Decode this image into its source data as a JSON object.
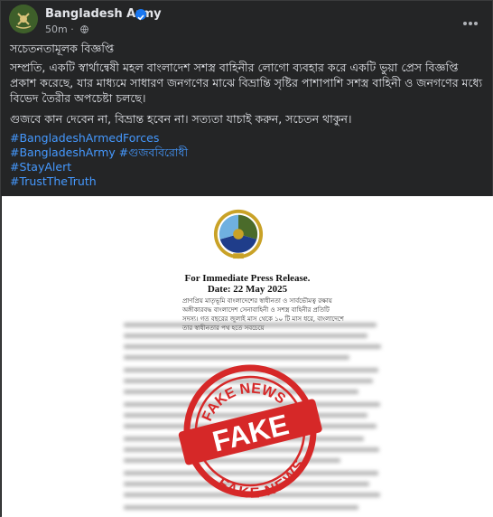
{
  "post": {
    "page_name": "Bangladesh Army",
    "time": "50m",
    "title": "সচেতনতামূলক বিজ্ঞপ্তি",
    "paragraph1": "সম্প্রতি, একটি স্বার্থান্বেষী মহল বাংলাদেশ সশস্ত্র বাহিনীর লোগো ব্যবহার করে একটি ভুয়া প্রেস বিজ্ঞপ্তি প্রকাশ করেছে, যার মাধ্যমে সাধারণ জনগণের মাঝে বিভ্রান্তি সৃষ্টির পাশাপাশি সশস্ত্র বাহিনী ও জনগণের মধ্যে বিভেদ তৈরীর অপচেষ্টা চলছে।",
    "paragraph2": "গুজবে কান দেবেন না, বিভ্রান্ত হবেন না। সত্যতা যাচাই করুন, সচেতন থাকুন।",
    "hashtags": [
      "#BangladeshArmedForces",
      "#BangladeshArmy",
      "#গুজববিরোধী",
      "#StayAlert",
      "#TrustTheTruth"
    ]
  },
  "image": {
    "release_heading": "For Immediate Press Release.",
    "release_date": "Date: 22 May 2025",
    "first_line": "প্রাণপ্রিয় মাতৃভূমি বাংলাদেশের স্বাধীনতা ও সার্বভৌমত্ব রক্ষায় অঙ্গীকারবদ্ধ বাংলাদেশ সেনাবাহিনী ও সশস্ত্র বাহিনীর প্রতিটি সদস্য। গত বছরের জুলাই মাস থেকে ১০ টি মাস ধরে, বাংলাদেশে তার স্বাধীনতার পথ হতে সবচেয়ে",
    "stamp_top": "FAKE NEWS",
    "stamp_main": "FAKE",
    "stamp_bottom": "FAKE NEWS"
  },
  "colors": {
    "link": "#4599ff",
    "stamp": "#d62828",
    "verified": "#1877f2"
  },
  "icons": [
    "army-logo-icon",
    "verified-badge-icon",
    "globe-icon",
    "more-options-icon",
    "armed-forces-emblem-icon"
  ]
}
